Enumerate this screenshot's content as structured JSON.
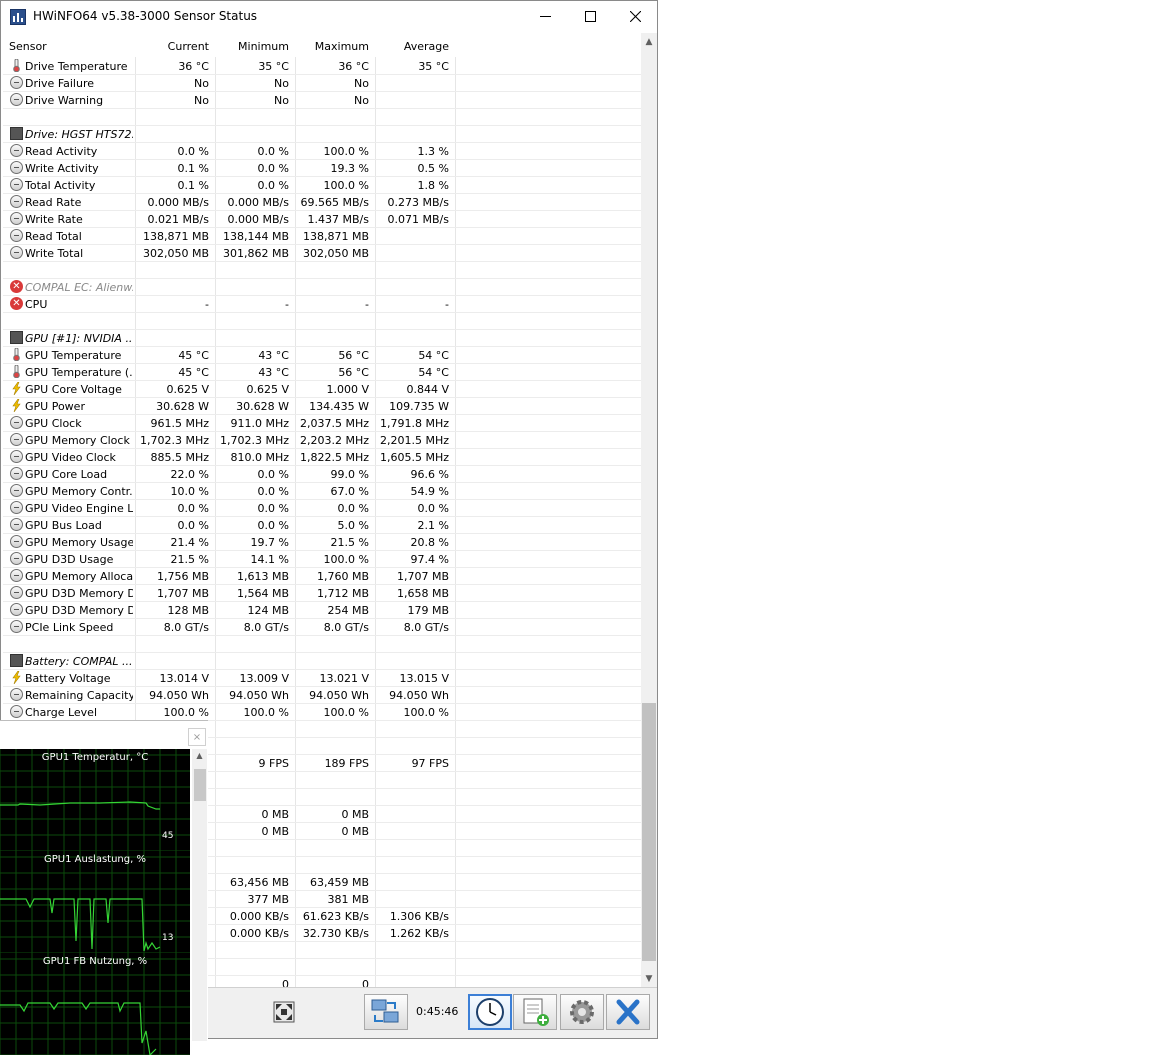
{
  "window": {
    "title": "HWiNFO64 v5.38-3000 Sensor Status"
  },
  "columns": [
    "Sensor",
    "Current",
    "Minimum",
    "Maximum",
    "Average"
  ],
  "rows": [
    {
      "icon": "thermometer-icon",
      "name": "Drive Temperature",
      "v": [
        "36 °C",
        "35 °C",
        "36 °C",
        "35 °C"
      ]
    },
    {
      "icon": "circle-icon",
      "name": "Drive Failure",
      "v": [
        "No",
        "No",
        "No",
        ""
      ]
    },
    {
      "icon": "circle-icon",
      "name": "Drive Warning",
      "v": [
        "No",
        "No",
        "No",
        ""
      ]
    },
    {
      "type": "blank"
    },
    {
      "type": "group",
      "icon": "drive-icon",
      "name": "Drive: HGST HTS72..."
    },
    {
      "icon": "circle-icon",
      "name": "Read Activity",
      "v": [
        "0.0 %",
        "0.0 %",
        "100.0 %",
        "1.3 %"
      ]
    },
    {
      "icon": "circle-icon",
      "name": "Write Activity",
      "v": [
        "0.1 %",
        "0.0 %",
        "19.3 %",
        "0.5 %"
      ]
    },
    {
      "icon": "circle-icon",
      "name": "Total Activity",
      "v": [
        "0.1 %",
        "0.0 %",
        "100.0 %",
        "1.8 %"
      ]
    },
    {
      "icon": "circle-icon",
      "name": "Read Rate",
      "v": [
        "0.000 MB/s",
        "0.000 MB/s",
        "69.565 MB/s",
        "0.273 MB/s"
      ]
    },
    {
      "icon": "circle-icon",
      "name": "Write Rate",
      "v": [
        "0.021 MB/s",
        "0.000 MB/s",
        "1.437 MB/s",
        "0.071 MB/s"
      ]
    },
    {
      "icon": "circle-icon",
      "name": "Read Total",
      "v": [
        "138,871 MB",
        "138,144 MB",
        "138,871 MB",
        ""
      ]
    },
    {
      "icon": "circle-icon",
      "name": "Write Total",
      "v": [
        "302,050 MB",
        "301,862 MB",
        "302,050 MB",
        ""
      ]
    },
    {
      "type": "blank"
    },
    {
      "type": "group",
      "disabled": true,
      "icon": "error-icon",
      "name": "COMPAL EC: Alienw..."
    },
    {
      "icon": "error-icon",
      "name": "CPU",
      "v": [
        "-",
        "-",
        "-",
        "-"
      ]
    },
    {
      "type": "blank"
    },
    {
      "type": "group",
      "icon": "drive-icon",
      "name": "GPU [#1]: NVIDIA ..."
    },
    {
      "icon": "thermometer-icon",
      "name": "GPU Temperature",
      "v": [
        "45 °C",
        "43 °C",
        "56 °C",
        "54 °C"
      ]
    },
    {
      "icon": "thermometer-icon",
      "name": "GPU Temperature (...",
      "v": [
        "45 °C",
        "43 °C",
        "56 °C",
        "54 °C"
      ]
    },
    {
      "icon": "lightning-icon",
      "name": "GPU Core Voltage",
      "v": [
        "0.625 V",
        "0.625 V",
        "1.000 V",
        "0.844 V"
      ]
    },
    {
      "icon": "lightning-icon",
      "name": "GPU Power",
      "v": [
        "30.628 W",
        "30.628 W",
        "134.435 W",
        "109.735 W"
      ]
    },
    {
      "icon": "circle-icon",
      "name": "GPU Clock",
      "v": [
        "961.5 MHz",
        "911.0 MHz",
        "2,037.5 MHz",
        "1,791.8 MHz"
      ]
    },
    {
      "icon": "circle-icon",
      "name": "GPU Memory Clock",
      "v": [
        "1,702.3 MHz",
        "1,702.3 MHz",
        "2,203.2 MHz",
        "2,201.5 MHz"
      ]
    },
    {
      "icon": "circle-icon",
      "name": "GPU Video Clock",
      "v": [
        "885.5 MHz",
        "810.0 MHz",
        "1,822.5 MHz",
        "1,605.5 MHz"
      ]
    },
    {
      "icon": "circle-icon",
      "name": "GPU Core Load",
      "v": [
        "22.0 %",
        "0.0 %",
        "99.0 %",
        "96.6 %"
      ]
    },
    {
      "icon": "circle-icon",
      "name": "GPU Memory Contr...",
      "v": [
        "10.0 %",
        "0.0 %",
        "67.0 %",
        "54.9 %"
      ]
    },
    {
      "icon": "circle-icon",
      "name": "GPU Video Engine L...",
      "v": [
        "0.0 %",
        "0.0 %",
        "0.0 %",
        "0.0 %"
      ]
    },
    {
      "icon": "circle-icon",
      "name": "GPU Bus Load",
      "v": [
        "0.0 %",
        "0.0 %",
        "5.0 %",
        "2.1 %"
      ]
    },
    {
      "icon": "circle-icon",
      "name": "GPU Memory Usage",
      "v": [
        "21.4 %",
        "19.7 %",
        "21.5 %",
        "20.8 %"
      ]
    },
    {
      "icon": "circle-icon",
      "name": "GPU D3D Usage",
      "v": [
        "21.5 %",
        "14.1 %",
        "100.0 %",
        "97.4 %"
      ]
    },
    {
      "icon": "circle-icon",
      "name": "GPU Memory Alloca...",
      "v": [
        "1,756 MB",
        "1,613 MB",
        "1,760 MB",
        "1,707 MB"
      ]
    },
    {
      "icon": "circle-icon",
      "name": "GPU D3D Memory D...",
      "v": [
        "1,707 MB",
        "1,564 MB",
        "1,712 MB",
        "1,658 MB"
      ]
    },
    {
      "icon": "circle-icon",
      "name": "GPU D3D Memory D...",
      "v": [
        "128 MB",
        "124 MB",
        "254 MB",
        "179 MB"
      ]
    },
    {
      "icon": "circle-icon",
      "name": "PCIe Link Speed",
      "v": [
        "8.0 GT/s",
        "8.0 GT/s",
        "8.0 GT/s",
        "8.0 GT/s"
      ]
    },
    {
      "type": "blank"
    },
    {
      "type": "group",
      "icon": "drive-icon",
      "name": "Battery: COMPAL ..."
    },
    {
      "icon": "lightning-icon",
      "name": "Battery Voltage",
      "v": [
        "13.014 V",
        "13.009 V",
        "13.021 V",
        "13.015 V"
      ]
    },
    {
      "icon": "circle-icon",
      "name": "Remaining Capacity",
      "v": [
        "94.050 Wh",
        "94.050 Wh",
        "94.050 Wh",
        "94.050 Wh"
      ]
    },
    {
      "icon": "circle-icon",
      "name": "Charge Level",
      "v": [
        "100.0 %",
        "100.0 %",
        "100.0 %",
        "100.0 %"
      ]
    },
    {
      "type": "blank"
    },
    {
      "type": "blank"
    },
    {
      "icon": "",
      "name": "",
      "v": [
        "",
        "9 FPS",
        "189 FPS",
        "97 FPS"
      ]
    },
    {
      "type": "blank"
    },
    {
      "type": "blank"
    },
    {
      "icon": "",
      "name": "",
      "v": [
        "",
        "0 MB",
        "0 MB",
        ""
      ]
    },
    {
      "icon": "",
      "name": "",
      "v": [
        "",
        "0 MB",
        "0 MB",
        ""
      ]
    },
    {
      "type": "blank"
    },
    {
      "type": "blank"
    },
    {
      "icon": "",
      "name": "",
      "v": [
        "",
        "63,456 MB",
        "63,459 MB",
        ""
      ]
    },
    {
      "icon": "",
      "name": "",
      "v": [
        "",
        "377 MB",
        "381 MB",
        ""
      ]
    },
    {
      "icon": "",
      "name": "",
      "v": [
        "",
        "0.000 KB/s",
        "61.623 KB/s",
        "1.306 KB/s"
      ]
    },
    {
      "icon": "",
      "name": "",
      "v": [
        "",
        "0.000 KB/s",
        "32.730 KB/s",
        "1.262 KB/s"
      ]
    },
    {
      "type": "blank"
    },
    {
      "type": "blank"
    },
    {
      "icon": "",
      "name": "",
      "v": [
        "",
        "0",
        "0",
        ""
      ]
    }
  ],
  "toolbar": {
    "timer": "0:45:46"
  },
  "graphs": [
    {
      "title": "GPU1 Temperatur, °C",
      "value": "45",
      "color": "#35d435"
    },
    {
      "title": "GPU1 Auslastung, %",
      "value": "13",
      "color": "#35d435"
    },
    {
      "title": "GPU1 FB Nutzung, %",
      "value": "",
      "color": "#35d435"
    }
  ],
  "graph_close": "×"
}
